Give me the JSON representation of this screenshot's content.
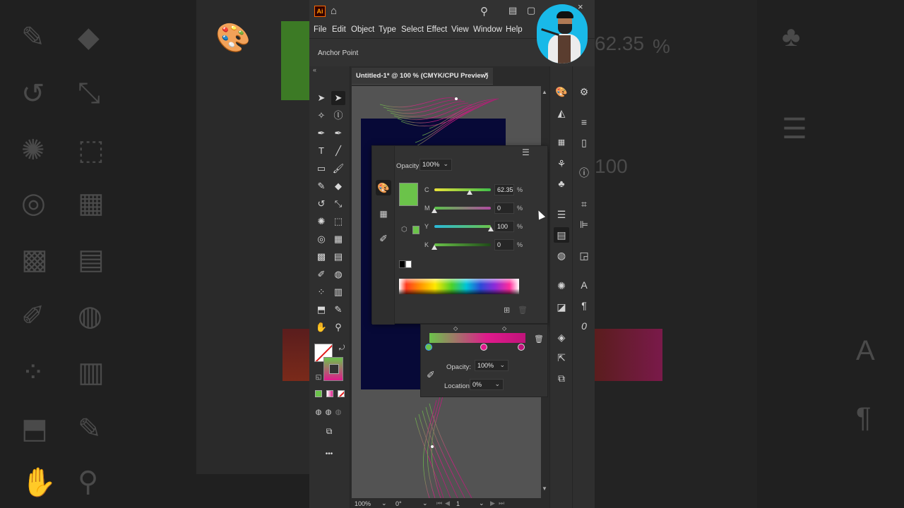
{
  "window": {
    "app_logo": "Ai",
    "home_icon": "home-icon",
    "search_icon": "search-icon",
    "close_glyph": "×"
  },
  "menubar": {
    "items": [
      "File",
      "Edit",
      "Object",
      "Type",
      "Select",
      "Effect",
      "View",
      "Window",
      "Help"
    ]
  },
  "control_bar": {
    "label": "Anchor Point"
  },
  "document_tab": {
    "title": "Untitled-1* @ 100 % (CMYK/CPU Preview)",
    "close_glyph": "×"
  },
  "color_panel": {
    "opacity_label": "Opacity:",
    "opacity_value": "100%",
    "swatch_color": "#6bc34a",
    "channels": [
      {
        "label": "C",
        "value": "62.35",
        "unit": "%",
        "level": 0.62
      },
      {
        "label": "M",
        "value": "0",
        "unit": "%",
        "level": 0
      },
      {
        "label": "Y",
        "value": "100",
        "unit": "%",
        "level": 1.0
      },
      {
        "label": "K",
        "value": "0",
        "unit": "%",
        "level": 0
      }
    ]
  },
  "gradient_panel": {
    "opacity_label": "Opacity:",
    "opacity_value": "100%",
    "location_label": "Location:",
    "location_value": "0%",
    "stops": [
      "#6bc34a",
      "#e01a8c",
      "#c0137a"
    ]
  },
  "status_bar": {
    "zoom": "100%",
    "rotation": "0°",
    "artboard": "1"
  },
  "colors": {
    "artboard": "#070937",
    "accent_green": "#6bc34a",
    "accent_magenta": "#e01a8c"
  },
  "more_tools": "•••"
}
